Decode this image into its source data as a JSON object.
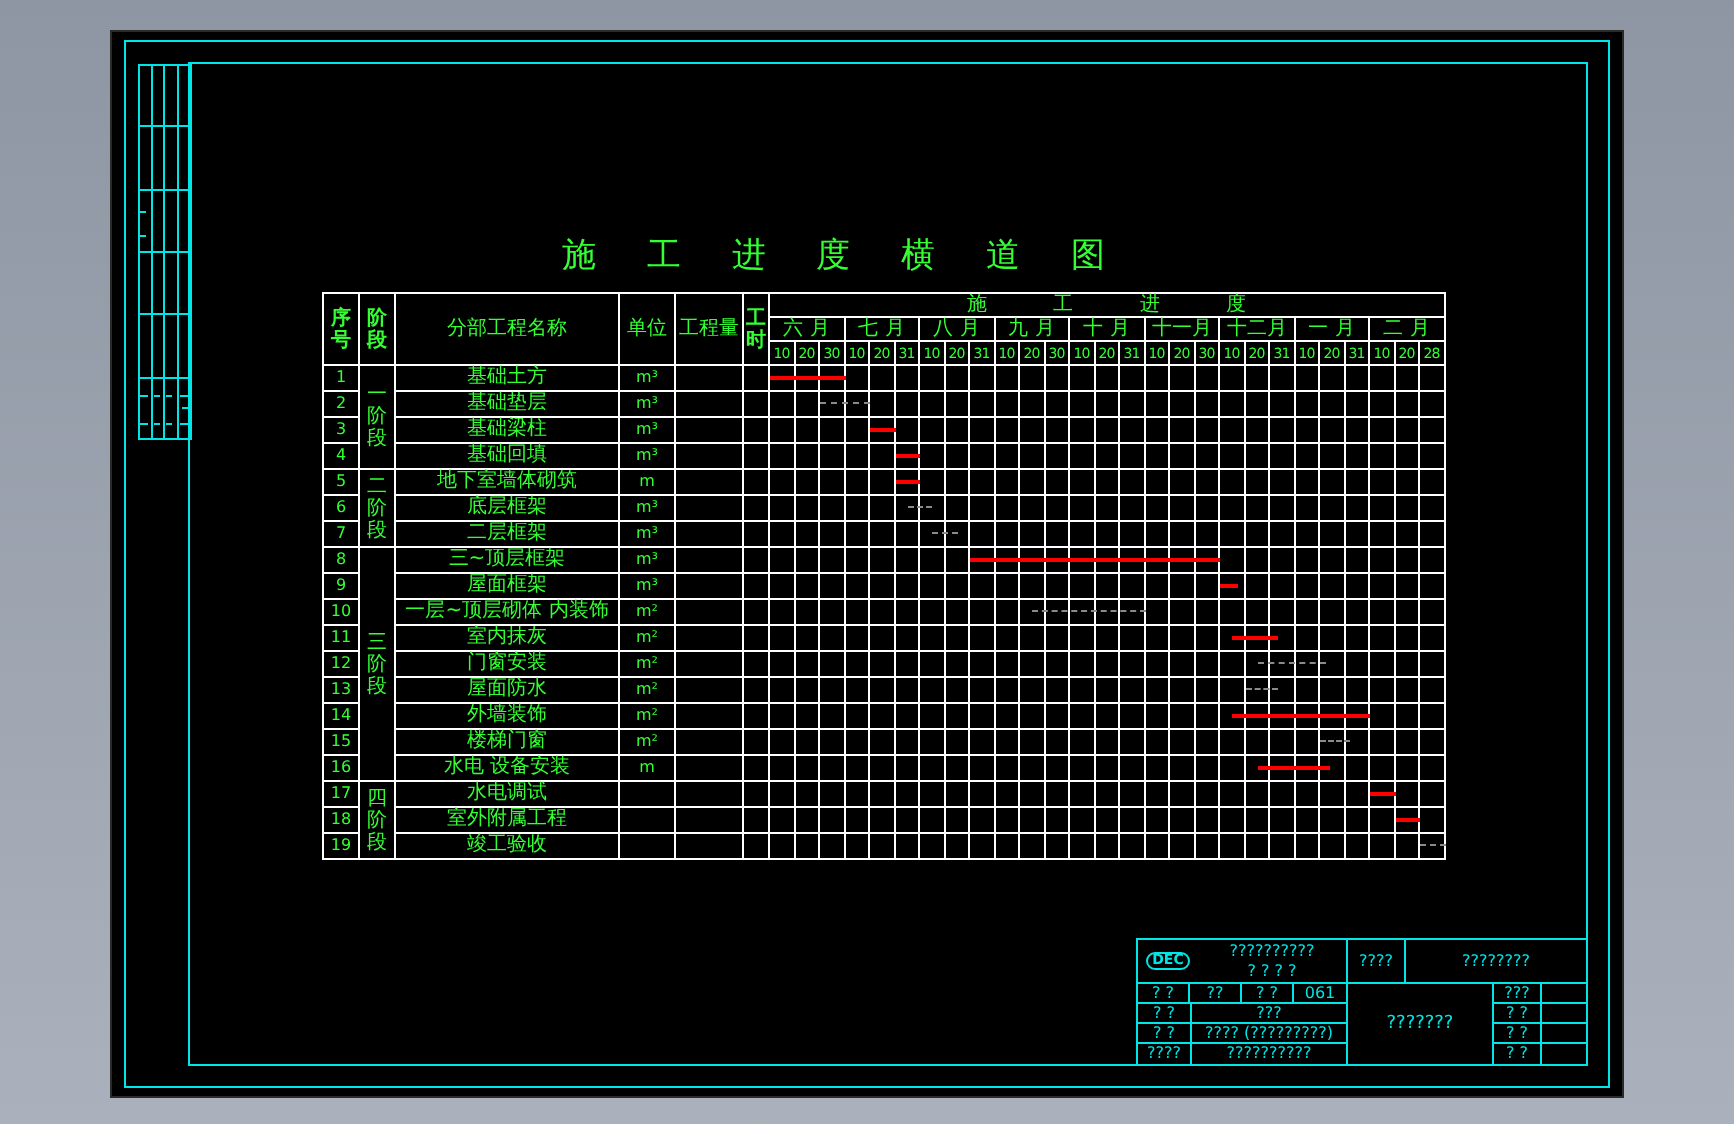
{
  "drawing": {
    "title": "施 工 进 度 横 道 图"
  },
  "table": {
    "headers": {
      "no": "序号",
      "phase": "阶段",
      "name": "分部工程名称",
      "unit": "单位",
      "quantity": "工程量",
      "hours": "工时",
      "progress": "施 工 进 度"
    },
    "months": [
      {
        "label": "六 月",
        "days": [
          "10",
          "20",
          "30"
        ]
      },
      {
        "label": "七 月",
        "days": [
          "10",
          "20",
          "31"
        ]
      },
      {
        "label": "八 月",
        "days": [
          "10",
          "20",
          "31"
        ]
      },
      {
        "label": "九 月",
        "days": [
          "10",
          "20",
          "30"
        ]
      },
      {
        "label": "十 月",
        "days": [
          "10",
          "20",
          "31"
        ]
      },
      {
        "label": "十一月",
        "days": [
          "10",
          "20",
          "30"
        ]
      },
      {
        "label": "十二月",
        "days": [
          "10",
          "20",
          "31"
        ]
      },
      {
        "label": "一 月",
        "days": [
          "10",
          "20",
          "31"
        ]
      },
      {
        "label": "二 月",
        "days": [
          "10",
          "20",
          "28"
        ]
      }
    ],
    "phases": [
      {
        "label": "一阶段",
        "tasks": [
          {
            "no": "1",
            "name": "基础土方",
            "unit": "m³",
            "kind": "actual"
          },
          {
            "no": "2",
            "name": "基础垫层",
            "unit": "m³",
            "kind": "planned"
          },
          {
            "no": "3",
            "name": "基础梁柱",
            "unit": "m³",
            "kind": "actual"
          },
          {
            "no": "4",
            "name": "基础回填",
            "unit": "m³",
            "kind": "actual"
          }
        ]
      },
      {
        "label": "二阶段",
        "tasks": [
          {
            "no": "5",
            "name": "地下室墙体砌筑",
            "unit": "m",
            "kind": "actual"
          },
          {
            "no": "6",
            "name": "底层框架",
            "unit": "m³",
            "kind": "planned"
          },
          {
            "no": "7",
            "name": "二层框架",
            "unit": "m³",
            "kind": "planned"
          }
        ]
      },
      {
        "label": "三阶段",
        "tasks": [
          {
            "no": "8",
            "name": "三~顶层框架",
            "unit": "m³",
            "kind": "actual"
          },
          {
            "no": "9",
            "name": "屋面框架",
            "unit": "m³",
            "kind": "actual"
          },
          {
            "no": "10",
            "name": "一层~顶层砌体 内装饰",
            "unit": "m²",
            "kind": "planned"
          },
          {
            "no": "11",
            "name": "室内抹灰",
            "unit": "m²",
            "kind": "actual"
          },
          {
            "no": "12",
            "name": "门窗安装",
            "unit": "m²",
            "kind": "planned"
          },
          {
            "no": "13",
            "name": "屋面防水",
            "unit": "m²",
            "kind": "planned"
          },
          {
            "no": "14",
            "name": "外墙装饰",
            "unit": "m²",
            "kind": "actual"
          },
          {
            "no": "15",
            "name": "楼梯门窗",
            "unit": "m²",
            "kind": "planned"
          },
          {
            "no": "16",
            "name": "水电 设备安装",
            "unit": "m",
            "kind": "actual"
          }
        ]
      },
      {
        "label": "四阶段",
        "tasks": [
          {
            "no": "17",
            "name": "水电调试",
            "kind": "actual"
          },
          {
            "no": "18",
            "name": "室外附属工程",
            "kind": "actual"
          },
          {
            "no": "19",
            "name": "竣工验收",
            "kind": "planned"
          }
        ]
      }
    ]
  },
  "title_block": {
    "logo": "DEC",
    "school": "??????????",
    "school_line_2": "? ? ? ?",
    "label": "????",
    "project": "????????",
    "rows": [
      [
        "? ?",
        "??",
        "? ?",
        "061"
      ],
      [
        "? ?",
        "???"
      ],
      [
        "? ?",
        "???? (?????????)"
      ],
      [
        "????",
        "??????????"
      ]
    ],
    "drawing_name": "???????",
    "side": [
      "???",
      "? ?",
      "? ?",
      "? ?"
    ]
  }
}
